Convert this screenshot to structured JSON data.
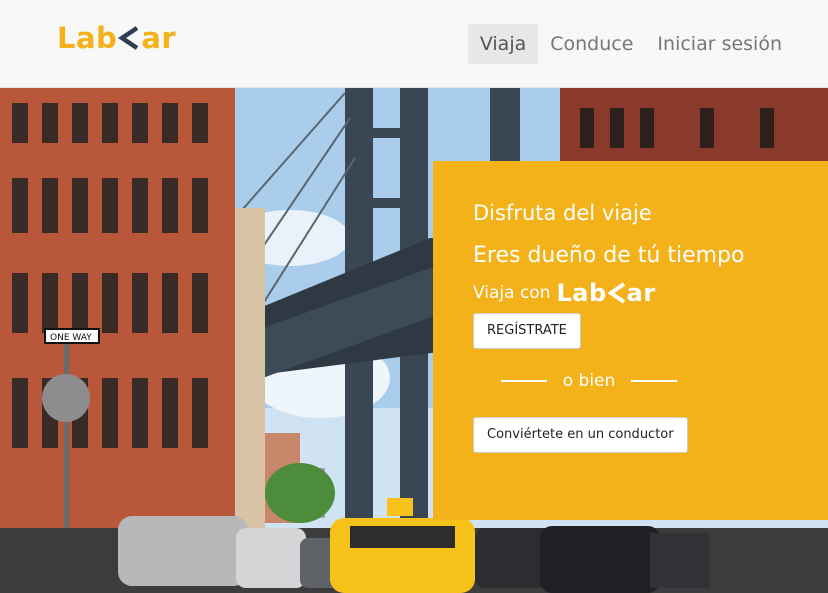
{
  "brand": {
    "logo_left": "Lab",
    "logo_right": "ar",
    "logo_color": "#f5b21b"
  },
  "nav": {
    "items": [
      {
        "label": "Viaja",
        "active": true
      },
      {
        "label": "Conduce",
        "active": false
      },
      {
        "label": "Iniciar sesión",
        "active": false
      }
    ]
  },
  "promo": {
    "line1": "Disfruta del viaje",
    "line2": "Eres dueño de tú tiempo",
    "line3_prefix": "Viaja con",
    "register_label": "REGÍSTRATE",
    "divider_text": "o bien",
    "driver_label": "Conviértete en un conductor",
    "background": "#f3b21a"
  },
  "hero": {
    "sign_text": "ONE WAY"
  }
}
